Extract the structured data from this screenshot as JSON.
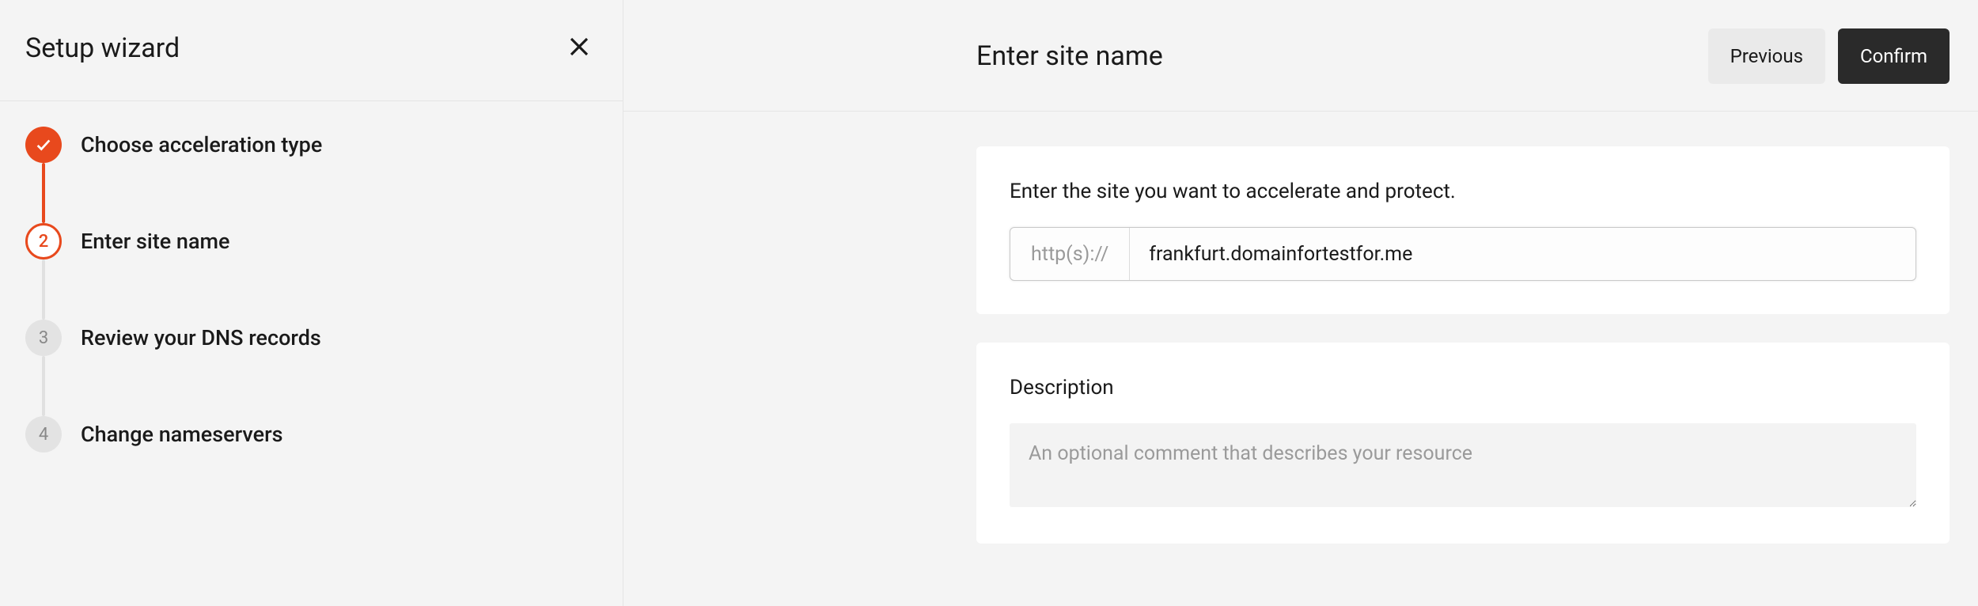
{
  "sidebar": {
    "title": "Setup wizard",
    "steps": [
      {
        "label": "Choose acceleration type",
        "state": "completed"
      },
      {
        "number": "2",
        "label": "Enter site name",
        "state": "current"
      },
      {
        "number": "3",
        "label": "Review your DNS records",
        "state": "pending"
      },
      {
        "number": "4",
        "label": "Change nameservers",
        "state": "pending"
      }
    ]
  },
  "main": {
    "title": "Enter site name",
    "previous_label": "Previous",
    "confirm_label": "Confirm",
    "site_card": {
      "label": "Enter the site you want to accelerate and protect.",
      "prefix": "http(s)://",
      "value": "frankfurt.domainfortestfor.me"
    },
    "description_card": {
      "label": "Description",
      "placeholder": "An optional comment that describes your resource"
    }
  }
}
